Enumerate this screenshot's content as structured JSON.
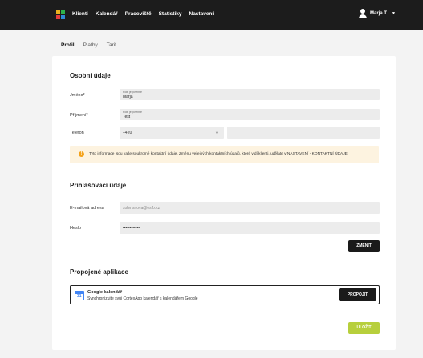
{
  "nav": {
    "items": [
      "Klienti",
      "Kalendář",
      "Pracoviště",
      "Statistiky",
      "Nastavení"
    ],
    "user_name": "Marja T."
  },
  "tabs": [
    "Profil",
    "Platby",
    "Tarif"
  ],
  "personal": {
    "title": "Osobní údaje",
    "first_name": {
      "label": "Jméno*",
      "hint": "Pole je povinné",
      "value": "Marja"
    },
    "last_name": {
      "label": "Příjmení*",
      "hint": "Pole je povinné",
      "value": "Test"
    },
    "phone": {
      "label": "Telefon",
      "prefix": "+420",
      "number": ""
    }
  },
  "info_text": "Tyto informace jsou vaše soukromé kontaktní údaje. Změnu veřejných kontaktních údajů, které vidí klienti, uděláte v NASTAVENÍ - KONTAKTNÍ ÚDAJE.",
  "login": {
    "title": "Přihlašovací údaje",
    "email": {
      "label": "E-mailová adresa",
      "value": "xolensnova@esfo.cz"
    },
    "password": {
      "label": "Heslo",
      "value": "••••••••••••"
    },
    "change_button": "ZMĚNIT"
  },
  "apps": {
    "title": "Propojené aplikace",
    "google": {
      "icon_text": "31",
      "name": "Google kalendář",
      "description": "Synchronizujte svůj CortexApp kalendář s kalendářem Google",
      "button": "PROPOJIT"
    }
  },
  "save_button": "ULOŽIT",
  "colors": {
    "accent": "#b7cf3c",
    "topbar": "#1c1c1c",
    "warning": "#f4a21a"
  }
}
